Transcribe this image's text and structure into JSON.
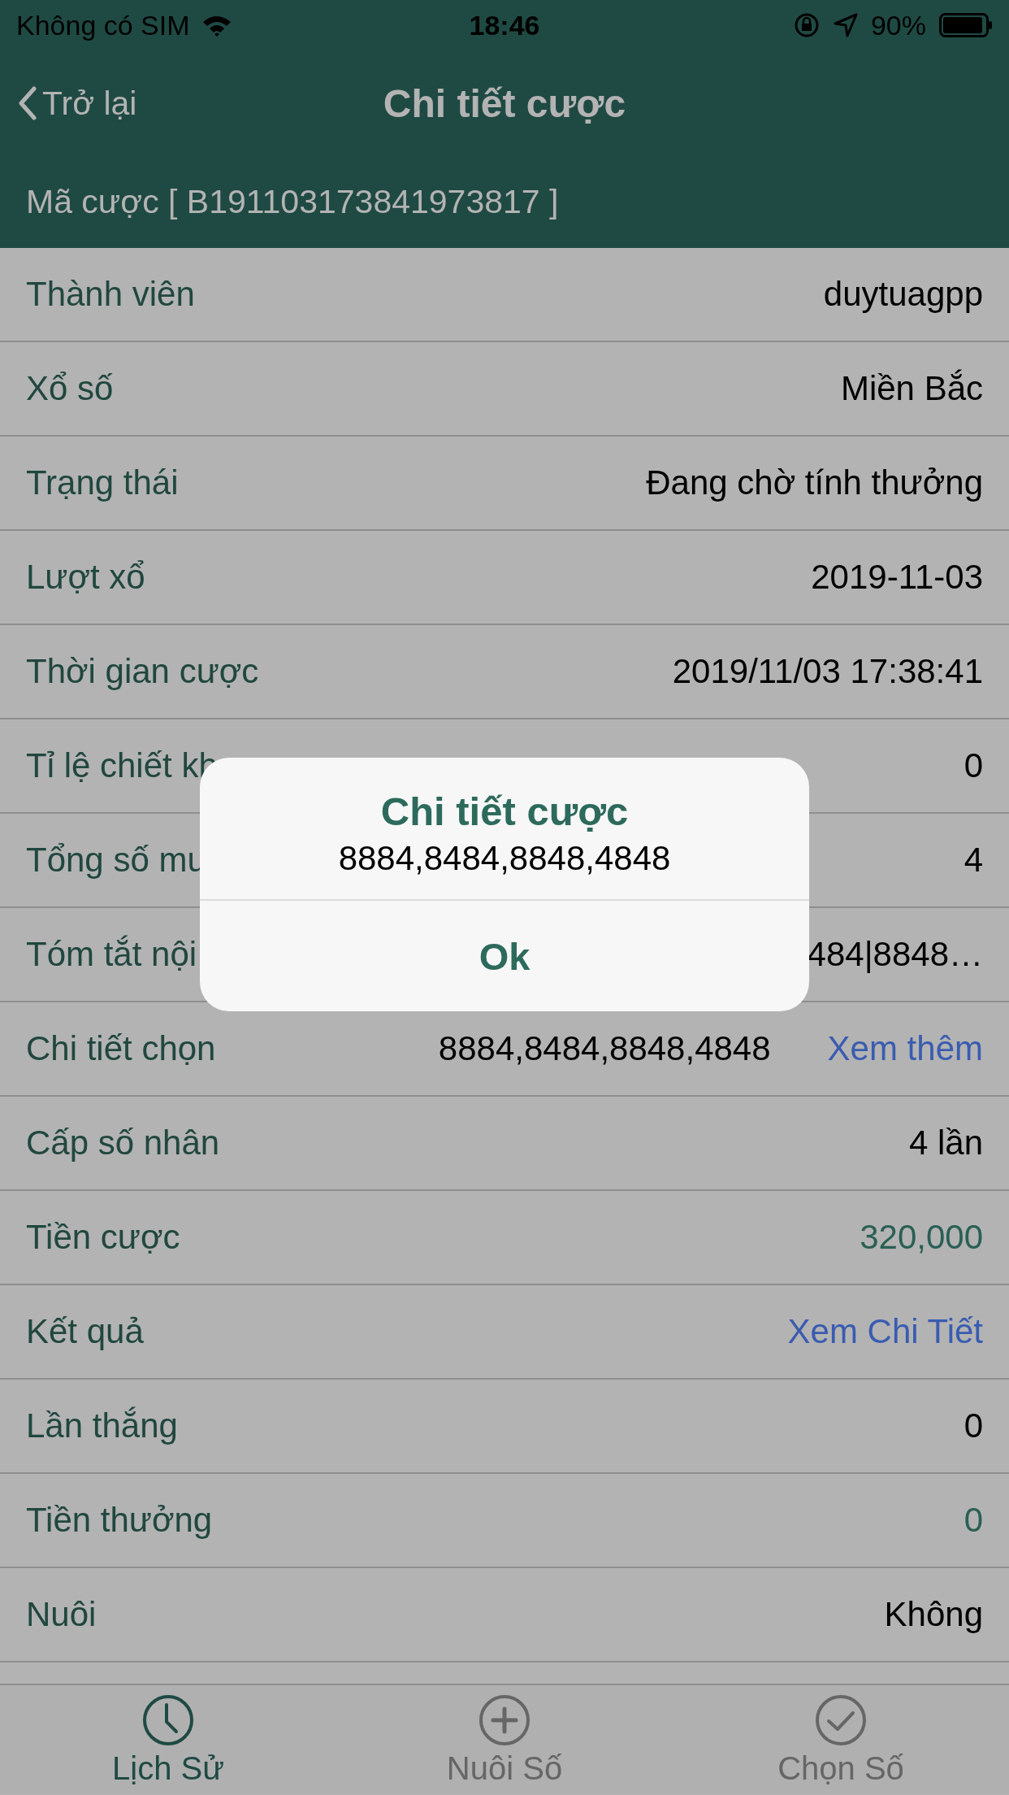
{
  "status_bar": {
    "carrier": "Không có SIM",
    "time": "18:46",
    "battery": "90%"
  },
  "nav": {
    "back": "Trở lại",
    "title": "Chi tiết cược"
  },
  "bet_code": "Mã cược [ B191103173841973817 ]",
  "rows": [
    {
      "label": "Thành viên",
      "value": "duytuagpp",
      "kind": "plain"
    },
    {
      "label": "Xổ số",
      "value": "Miền Bắc",
      "kind": "plain"
    },
    {
      "label": "Trạng thái",
      "value": "Đang chờ tính thưởng",
      "kind": "plain"
    },
    {
      "label": "Lượt xổ",
      "value": "2019-11-03",
      "kind": "plain"
    },
    {
      "label": "Thời gian cược",
      "value": "2019/11/03 17:38:41",
      "kind": "plain"
    },
    {
      "label": "Tỉ lệ chiết kh",
      "value": "0",
      "kind": "plain"
    },
    {
      "label": "Tổng số mu",
      "value": "4",
      "kind": "plain"
    },
    {
      "label": "Tóm tắt nội",
      "value": "484|8848…",
      "kind": "plain"
    },
    {
      "label": "Chi tiết chọn",
      "value": "8884,8484,8848,4848",
      "kind": "plain",
      "link": "Xem thêm"
    },
    {
      "label": "Cấp số nhân",
      "value": "4 lần",
      "kind": "plain"
    },
    {
      "label": "Tiền cược",
      "value": "320,000",
      "kind": "accent"
    },
    {
      "label": "Kết quả",
      "value": "Xem Chi Tiết",
      "kind": "link"
    },
    {
      "label": "Lần thắng",
      "value": "0",
      "kind": "plain"
    },
    {
      "label": "Tiền thưởng",
      "value": "0",
      "kind": "accent"
    },
    {
      "label": "Nuôi",
      "value": "Không",
      "kind": "plain"
    }
  ],
  "tabs": [
    {
      "label": "Lịch Sử",
      "selected": true
    },
    {
      "label": "Nuôi Số",
      "selected": false
    },
    {
      "label": "Chọn Số",
      "selected": false
    }
  ],
  "dialog": {
    "title": "Chi tiết cược",
    "message": "8884,8484,8848,4848",
    "button": "Ok"
  }
}
